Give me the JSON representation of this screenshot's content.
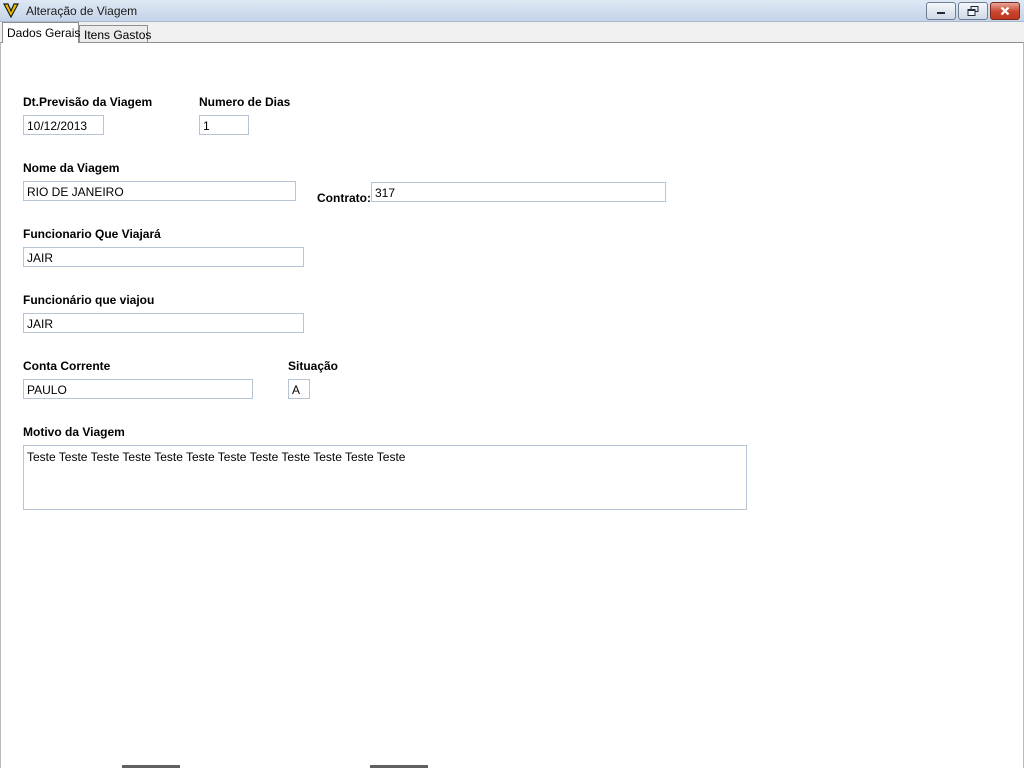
{
  "window": {
    "title": "Alteração de Viagem",
    "icon": "app-logo-icon",
    "controls": [
      "minimize-icon",
      "restore-icon",
      "close-icon"
    ]
  },
  "tabs": [
    {
      "label": "Dados Gerais",
      "active": true
    },
    {
      "label": "Itens Gastos",
      "active": false
    }
  ],
  "form": {
    "dt_previsao": {
      "label": "Dt.Previsão da Viagem",
      "value": "10/12/2013"
    },
    "numero_dias": {
      "label": "Numero de Dias",
      "value": "1"
    },
    "nome_viagem": {
      "label": "Nome da Viagem",
      "value": "RIO DE JANEIRO"
    },
    "contrato": {
      "label": "Contrato:",
      "value": "317"
    },
    "funcionario_viajara": {
      "label": "Funcionario Que Viajará",
      "value": "JAIR"
    },
    "funcionario_viajou": {
      "label": "Funcionário que viajou",
      "value": "JAIR"
    },
    "conta_corrente": {
      "label": "Conta Corrente",
      "value": "PAULO"
    },
    "situacao": {
      "label": "Situação",
      "value": "A"
    },
    "motivo": {
      "label": "Motivo da Viagem",
      "value": "Teste  Teste Teste Teste Teste Teste Teste Teste Teste Teste Teste Teste"
    }
  },
  "colors": {
    "titlebar": "#c4d4e8",
    "close_button": "#c9452e",
    "field_border": "#b5c5d6"
  }
}
